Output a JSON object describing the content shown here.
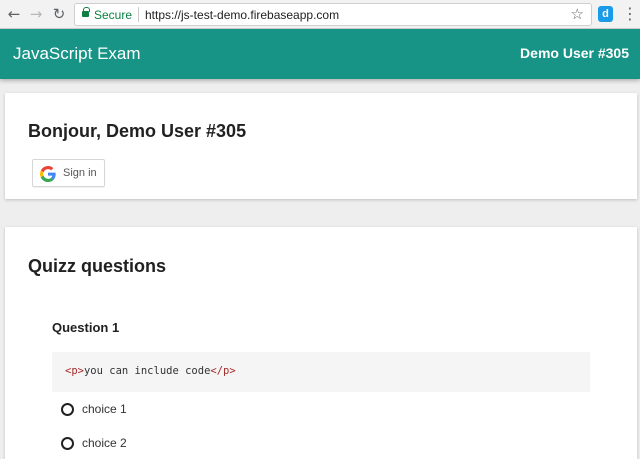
{
  "browser": {
    "secure_label": "Secure",
    "url": "https://js-test-demo.firebaseapp.com",
    "extension_letter": "d"
  },
  "appbar": {
    "title": "JavaScript Exam",
    "user": "Demo User #305",
    "color": "#179486"
  },
  "greeting": {
    "text": "Bonjour, Demo User #305",
    "signin_label": "Sign in"
  },
  "quiz": {
    "title": "Quizz questions",
    "questions": [
      {
        "title": "Question 1",
        "code": {
          "open_tag": "<p>",
          "text": "you can include code",
          "close_tag": "</p>"
        },
        "choices": [
          {
            "label": "choice 1",
            "selected": false
          },
          {
            "label": "choice 2",
            "selected": false
          }
        ]
      }
    ]
  }
}
